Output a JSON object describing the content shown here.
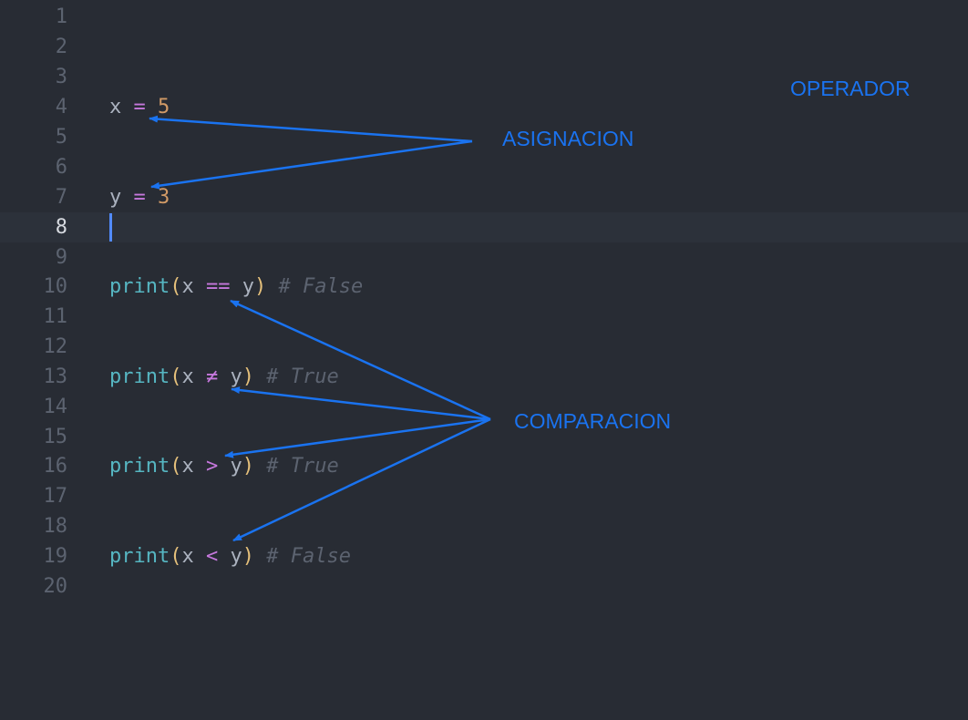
{
  "editor": {
    "lines": [
      {
        "number": "1"
      },
      {
        "number": "2"
      },
      {
        "number": "3"
      },
      {
        "number": "4",
        "tokens": {
          "var": "x",
          "op": "=",
          "val": "5"
        }
      },
      {
        "number": "5"
      },
      {
        "number": "6"
      },
      {
        "number": "7",
        "tokens": {
          "var": "y",
          "op": "=",
          "val": "3"
        }
      },
      {
        "number": "8"
      },
      {
        "number": "9"
      },
      {
        "number": "10",
        "tokens": {
          "fn": "print",
          "open": "(",
          "a": "x",
          "op": "==",
          "b": "y",
          "close": ")",
          "comment": "# False"
        }
      },
      {
        "number": "11"
      },
      {
        "number": "12"
      },
      {
        "number": "13",
        "tokens": {
          "fn": "print",
          "open": "(",
          "a": "x",
          "op": "≠",
          "b": "y",
          "close": ")",
          "comment": "# True"
        }
      },
      {
        "number": "14"
      },
      {
        "number": "15"
      },
      {
        "number": "16",
        "tokens": {
          "fn": "print",
          "open": "(",
          "a": "x",
          "op": ">",
          "b": "y",
          "close": ")",
          "comment": "# True"
        }
      },
      {
        "number": "17"
      },
      {
        "number": "18"
      },
      {
        "number": "19",
        "tokens": {
          "fn": "print",
          "open": "(",
          "a": "x",
          "op": "<",
          "b": "y",
          "close": ")",
          "comment": "# False"
        }
      },
      {
        "number": "20"
      }
    ],
    "active_line": "8"
  },
  "annotations": {
    "operador": "OPERADOR",
    "asignacion": "ASIGNACION",
    "comparacion": "COMPARACION",
    "color": "#1a73f0"
  },
  "theme": {
    "background": "#282c34",
    "line_numbers": "#5c6370",
    "function": "#56b6c2",
    "operator": "#c678dd",
    "number": "#d19a66",
    "paren": "#e5c07b",
    "comment": "#5c6370"
  }
}
